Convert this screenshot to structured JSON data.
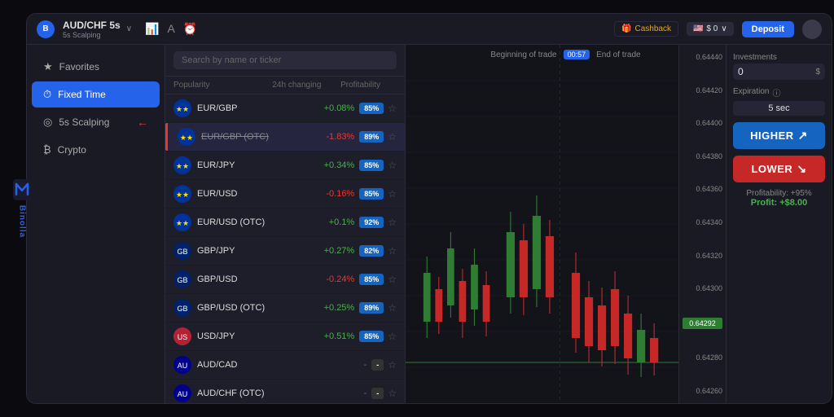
{
  "app": {
    "title": "Binolla",
    "pair": "AUD/CHF 5s",
    "pair_sub": "5s Scalping",
    "pair_arrow": "∨"
  },
  "topbar": {
    "cashback_label": "Cashback",
    "balance_label": "$ 0",
    "deposit_label": "Deposit"
  },
  "sidebar": {
    "items": [
      {
        "id": "favorites",
        "label": "Favorites",
        "icon": "★",
        "active": false
      },
      {
        "id": "fixed-time",
        "label": "Fixed Time",
        "icon": "⏱",
        "active": true
      },
      {
        "id": "scalping",
        "label": "5s Scalping",
        "icon": "⊙",
        "active": false
      },
      {
        "id": "crypto",
        "label": "Crypto",
        "icon": "₿",
        "active": false
      }
    ]
  },
  "search": {
    "placeholder": "Search by name or ticker"
  },
  "table_headers": {
    "popularity": "Popularity",
    "change": "24h changing",
    "profitability": "Profitability"
  },
  "pairs": [
    {
      "name": "EUR/GBP",
      "change": "+0.08%",
      "change_type": "pos",
      "profit": "85%",
      "flags": [
        "EU",
        "GB"
      ],
      "strikethrough": false
    },
    {
      "name": "EUR/GBP (OTC)",
      "change": "-1.83%",
      "change_type": "neg",
      "profit": "89%",
      "flags": [
        "EU",
        "GB"
      ],
      "strikethrough": true
    },
    {
      "name": "EUR/JPY",
      "change": "+0.34%",
      "change_type": "pos",
      "profit": "85%",
      "flags": [
        "EU",
        "JP"
      ],
      "strikethrough": false
    },
    {
      "name": "EUR/USD",
      "change": "-0.16%",
      "change_type": "neg",
      "profit": "85%",
      "flags": [
        "EU",
        "US"
      ],
      "strikethrough": false
    },
    {
      "name": "EUR/USD (OTC)",
      "change": "+0.1%",
      "change_type": "pos",
      "profit": "92%",
      "flags": [
        "EU",
        "US"
      ],
      "strikethrough": false
    },
    {
      "name": "GBP/JPY",
      "change": "+0.27%",
      "change_type": "pos",
      "profit": "82%",
      "flags": [
        "GB",
        "JP"
      ],
      "strikethrough": false
    },
    {
      "name": "GBP/USD",
      "change": "-0.24%",
      "change_type": "neg",
      "profit": "85%",
      "flags": [
        "GB",
        "US"
      ],
      "strikethrough": false
    },
    {
      "name": "GBP/USD (OTC)",
      "change": "+0.25%",
      "change_type": "pos",
      "profit": "89%",
      "flags": [
        "GB",
        "US"
      ],
      "strikethrough": false
    },
    {
      "name": "USD/JPY",
      "change": "+0.51%",
      "change_type": "pos",
      "profit": "85%",
      "flags": [
        "US",
        "JP"
      ],
      "strikethrough": false
    },
    {
      "name": "AUD/CAD",
      "change": "-",
      "change_type": "neutral",
      "profit": "-",
      "flags": [
        "AU",
        "CA"
      ],
      "strikethrough": false
    },
    {
      "name": "AUD/CHF (OTC)",
      "change": "-",
      "change_type": "neutral",
      "profit": "-",
      "flags": [
        "AU",
        "CH"
      ],
      "strikethrough": false
    }
  ],
  "chart": {
    "begin_label": "Beginning of trade",
    "end_label": "End of trade",
    "timer": "00:57",
    "prices": [
      "0.64440",
      "0.64420",
      "0.64400",
      "0.64380",
      "0.64360",
      "0.64340",
      "0.64320",
      "0.64300",
      "0.64280",
      "0.64260"
    ],
    "current_price": "0.64292"
  },
  "right_panel": {
    "investments_label": "Investments",
    "investments_value": "0",
    "investments_currency": "$",
    "expiration_label": "Expiration",
    "expiration_value": "5 sec",
    "higher_label": "HIGHER",
    "lower_label": "LOWER",
    "profitability_label": "Profitability: +95%",
    "profit_value": "Profit: +$8.00"
  }
}
